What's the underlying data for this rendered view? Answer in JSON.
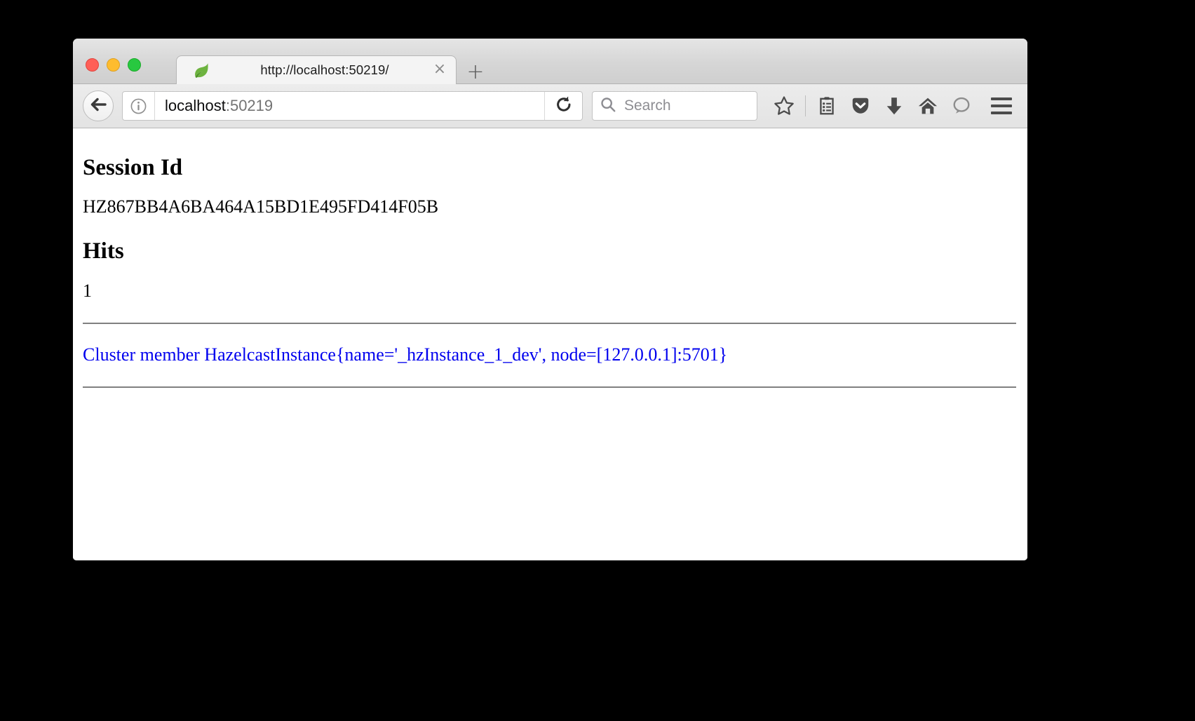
{
  "window": {
    "traffic_lights": [
      {
        "name": "close",
        "color": "#ff5f57"
      },
      {
        "name": "minimize",
        "color": "#febc2e"
      },
      {
        "name": "zoom",
        "color": "#28c840"
      }
    ]
  },
  "tabbar": {
    "favicon_name": "spring-leaf-favicon",
    "tab_title": "http://localhost:50219/",
    "close_label": "×",
    "new_tab_label": "+"
  },
  "navbar": {
    "back_icon": "back-arrow-icon",
    "identity_icon": "info-icon",
    "url_host": "localhost",
    "url_port": ":50219",
    "reload_icon": "reload-icon",
    "search_placeholder": "Search",
    "search_value": "",
    "icons": [
      {
        "name": "bookmark-star-icon",
        "label": "star"
      },
      {
        "name": "reader-list-icon",
        "label": "reading list"
      },
      {
        "name": "pocket-icon",
        "label": "Pocket"
      },
      {
        "name": "downloads-icon",
        "label": "Downloads"
      },
      {
        "name": "home-icon",
        "label": "Home"
      },
      {
        "name": "hello-chat-icon",
        "label": "Hello"
      }
    ],
    "menu_icon": "hamburger-menu-icon"
  },
  "page": {
    "session_heading": "Session Id",
    "session_id": "HZ867BB4A6BA464A15BD1E495FD414F05B",
    "hits_heading": "Hits",
    "hits_value": "1",
    "cluster_member_link": "Cluster member HazelcastInstance{name='_hzInstance_1_dev', node=[127.0.0.1]:5701}",
    "link_color": "#0000ee"
  }
}
